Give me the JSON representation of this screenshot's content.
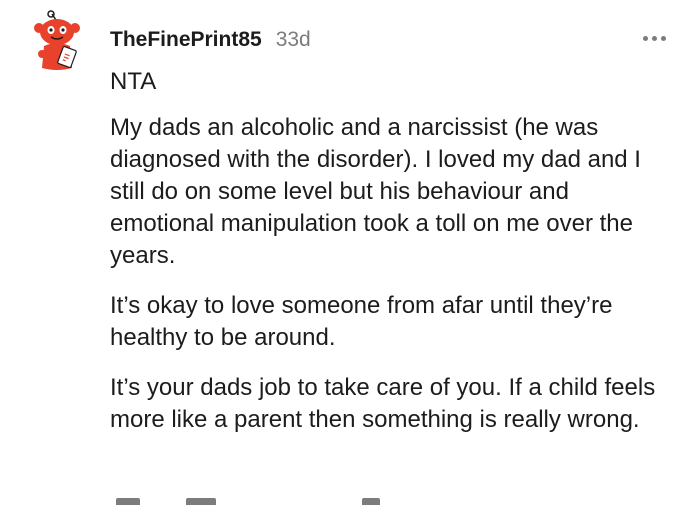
{
  "comment": {
    "username": "TheFinePrint85",
    "age": "33d",
    "verdict": "NTA",
    "paragraphs": [
      "My dads an alcoholic and a narcissist (he was diagnosed with the disorder). I loved my dad and I still do on some level but his behaviour and emotional manipulation took a toll on me over the years.",
      "It’s okay to love someone from afar until they’re healthy to be around.",
      "It’s your dads job to take care of you. If a child feels more like a parent then something is really wrong."
    ]
  },
  "colors": {
    "avatar_red": "#e8412c",
    "text": "#1c1c1c",
    "meta": "#7c7c7c"
  },
  "icons": {
    "avatar": "snoo-avatar-icon",
    "more": "more-options-icon"
  }
}
